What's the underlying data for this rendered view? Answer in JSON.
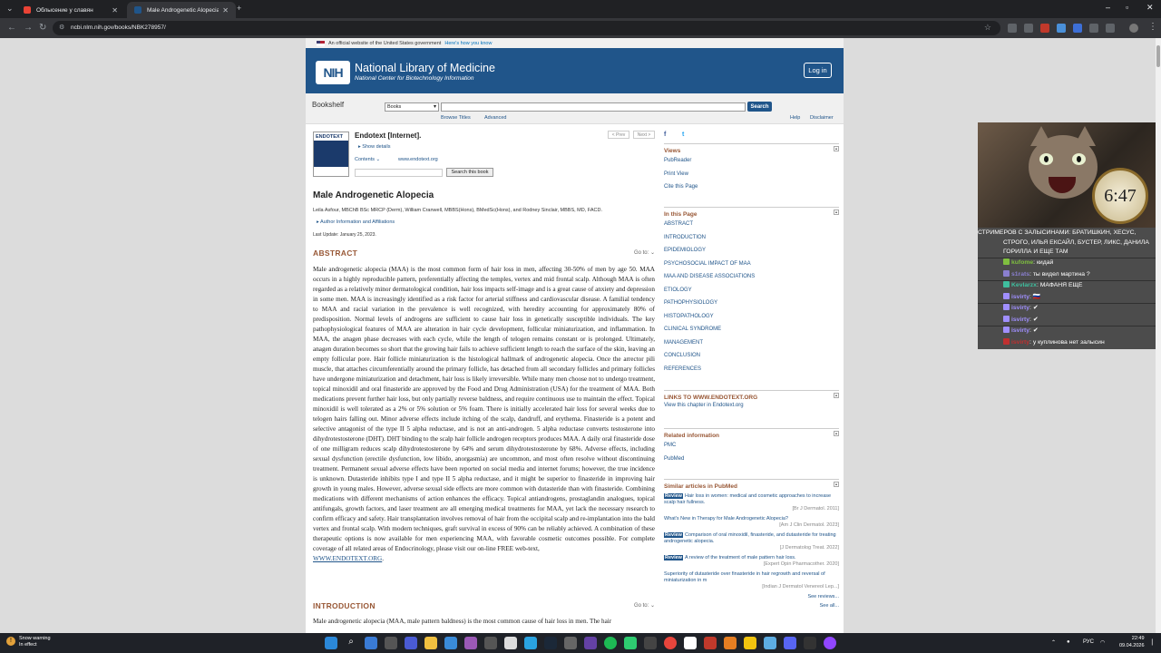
{
  "browser": {
    "tabs": [
      {
        "title": "Облысение у славян",
        "active": false
      },
      {
        "title": "Male Androgenetic Alopecia - E",
        "active": true
      }
    ],
    "url": "ncbi.nlm.nih.gov/books/NBK278957/"
  },
  "gov_banner": {
    "text": "An official website of the United States government",
    "link": "Here's how you know"
  },
  "nlm": {
    "logo": "NIH",
    "title": "National Library of Medicine",
    "subtitle": "National Center for Biotechnology Information",
    "login": "Log in"
  },
  "search": {
    "label": "Bookshelf",
    "db_selected": "Books",
    "button": "Search",
    "browse_titles": "Browse Titles",
    "advanced": "Advanced",
    "help": "Help",
    "disclaimer": "Disclaimer"
  },
  "book": {
    "cover_label": "ENDOTEXT",
    "title": "Endotext [Internet].",
    "show_details": "Show details",
    "contents": "Contents",
    "site": "www.endotext.org",
    "search_button": "Search this book",
    "prev": "< Prev",
    "next": "Next >"
  },
  "article": {
    "title": "Male Androgenetic Alopecia",
    "authors": "Leila Asfour, MBChB BSc MRCP (Derm), William Cranwell, MBBS(Hons), BMedSc(Hons), and Rodney Sinclair, MBBS, MD, FACD.",
    "affiliations": "Author Information and Affiliations",
    "last_update": "Last Update: January 25, 2023.",
    "abstract_heading": "ABSTRACT",
    "goto": "Go to:",
    "abstract": "Male androgenetic alopecia (MAA) is the most common form of hair loss in men, affecting 30-50% of men by age 50. MAA occurs in a highly reproducible pattern, preferentially affecting the temples, vertex and mid frontal scalp. Although MAA is often regarded as a relatively minor dermatological condition, hair loss impacts self-image and is a great cause of anxiety and depression in some men. MAA is increasingly identified as a risk factor for arterial stiffness and cardiovascular disease. A familial tendency to MAA and racial variation in the prevalence is well recognized, with heredity accounting for approximately 80% of predisposition. Normal levels of androgens are sufficient to cause hair loss in genetically susceptible individuals. The key pathophysiological features of MAA are alteration in hair cycle development, follicular miniaturization, and inflammation. In MAA, the anagen phase decreases with each cycle, while the length of telogen remains constant or is prolonged. Ultimately, anagen duration becomes so short that the growing hair fails to achieve sufficient length to reach the surface of the skin, leaving an empty follicular pore. Hair follicle miniaturization is the histological hallmark of androgenetic alopecia. Once the arrector pili muscle, that attaches circumferentially around the primary follicle, has detached from all secondary follicles and primary follicles have undergone miniaturization and detachment, hair loss is likely irreversible. While many men choose not to undergo treatment, topical minoxidil and oral finasteride are approved by the Food and Drug Administration (USA) for the treatment of MAA. Both medications prevent further hair loss, but only partially reverse baldness, and require continuous use to maintain the effect. Topical minoxidil is well tolerated as a 2% or 5% solution or 5% foam. There is initially accelerated hair loss for several weeks due to telogen hairs falling out. Minor adverse effects include itching of the scalp, dandruff, and erythema. Finasteride is a potent and selective antagonist of the type II 5 alpha reductase, and is not an anti-androgen. 5 alpha reductase converts testosterone into dihydrotestosterone (DHT). DHT binding to the scalp hair follicle androgen receptors produces MAA. A daily oral finasteride dose of one milligram reduces scalp dihydrotestosterone by 64% and serum dihydrotestosterone by 68%. Adverse effects, including sexual dysfunction (erectile dysfunction, low libido, anorgasmia) are uncommon, and most often resolve without discontinuing treatment. Permanent sexual adverse effects have been reported on social media and internet forums; however, the true incidence is unknown. Dutasteride inhibits type I and type II 5 alpha reductase, and it might be superior to finasteride in improving hair growth in young males. However, adverse sexual side effects are more common with dutasteride than with finasteride. Combining medications with different mechanisms of action enhances the efficacy. Topical antiandrogens, prostaglandin analogues, topical antifungals, growth factors, and laser treatment are all emerging medical treatments for MAA, yet lack the necessary research to confirm efficacy and safety. Hair transplantation involves removal of hair from the occipital scalp and re-implantation into the bald vertex and frontal scalp. With modern techniques, graft survival in excess of 90% can be reliably achieved. A combination of these therapeutic options is now available for men experiencing MAA, with favorable cosmetic outcomes possible. For complete coverage of all related areas of Endocrinology, please visit our on-line FREE web-text,",
    "abstract_link": "WWW.ENDOTEXT.ORG",
    "intro_heading": "INTRODUCTION",
    "intro_text": "Male androgenetic alopecia (MAA, male pattern baldness) is the most common cause of hair loss in men. The hair"
  },
  "sidebar": {
    "views": {
      "heading": "Views",
      "items": [
        "PubReader",
        "Print View",
        "Cite this Page"
      ]
    },
    "in_this_page": {
      "heading": "In this Page",
      "items": [
        "ABSTRACT",
        "INTRODUCTION",
        "EPIDEMIOLOGY",
        "PSYCHOSOCIAL IMPACT OF MAA",
        "MAA AND DISEASE ASSOCIATIONS",
        "ETIOLOGY",
        "PATHOPHYSIOLOGY",
        "HISTOPATHOLOGY",
        "CLINICAL SYNDROME",
        "MANAGEMENT",
        "CONCLUSION",
        "REFERENCES"
      ]
    },
    "links": {
      "heading": "LINKS TO WWW.ENDOTEXT.ORG",
      "item": "View this chapter in Endotext.org"
    },
    "related": {
      "heading": "Related information",
      "items": [
        "PMC",
        "PubMed"
      ]
    },
    "similar": {
      "heading": "Similar articles in PubMed",
      "review_label": "Review",
      "articles": [
        {
          "review": true,
          "title": "Hair loss in women: medical and cosmetic approaches to increase scalp hair fullness.",
          "source": "[Br J Dermatol. 2011]"
        },
        {
          "review": false,
          "title": "What's New in Therapy for Male Androgenetic Alopecia?",
          "source": "[Am J Clin Dermatol. 2023]"
        },
        {
          "review": true,
          "title": "Comparison of oral minoxidil, finasteride, and dutasteride for treating androgenetic alopecia.",
          "source": "[J Dermatolog Treat. 2022]"
        },
        {
          "review": true,
          "title": "A review of the treatment of male pattern hair loss.",
          "source": "[Expert Opin Pharmacother. 2020]"
        },
        {
          "review": false,
          "title": "Superiority of dutasteride over finasteride in hair regrowth and reversal of miniaturization in m",
          "source": "[Indian J Dermatol Venereol Lep...]"
        }
      ],
      "see_reviews": "See reviews...",
      "see_all": "See all..."
    }
  },
  "stream": {
    "clock_text": "6:47",
    "chat_first": "СТРИМЕРОВ С ЗАЛЫСИНАМИ: БРАТИШКИН, ХЕСУС, СТРОГО, ИЛЬЯ ЕКСАЙЛ, БУСТЕР, ЛИКС, ДАНИЛА ГОРИЛЛА И ЕЩЕ ТАМ",
    "messages": [
      {
        "user": "kufome",
        "text": "кидай",
        "color": "#7fbf3f"
      },
      {
        "user": "s1rats",
        "text": "ты видел мартина ?",
        "color": "#8a7fcf"
      },
      {
        "user": "Kevlarzx",
        "text": "МАФАНЯ ЕЩЕ",
        "color": "#3fbf9f"
      },
      {
        "user": "isvirty",
        "text": "🇷🇺",
        "color": "#a08fff"
      },
      {
        "user": "isvirty",
        "text": "✔",
        "color": "#a08fff"
      },
      {
        "user": "isvirty",
        "text": "✔",
        "color": "#a08fff"
      },
      {
        "user": "isvirty",
        "text": "✔",
        "color": "#a08fff"
      },
      {
        "user": "isvirty",
        "text": "у куплинова нет залысин",
        "color": "#c03030"
      }
    ]
  },
  "taskbar": {
    "weather_title": "Snow warning",
    "weather_sub": "In effect",
    "lang": "РУС",
    "time": "22:49",
    "date": "09.04.2026"
  }
}
